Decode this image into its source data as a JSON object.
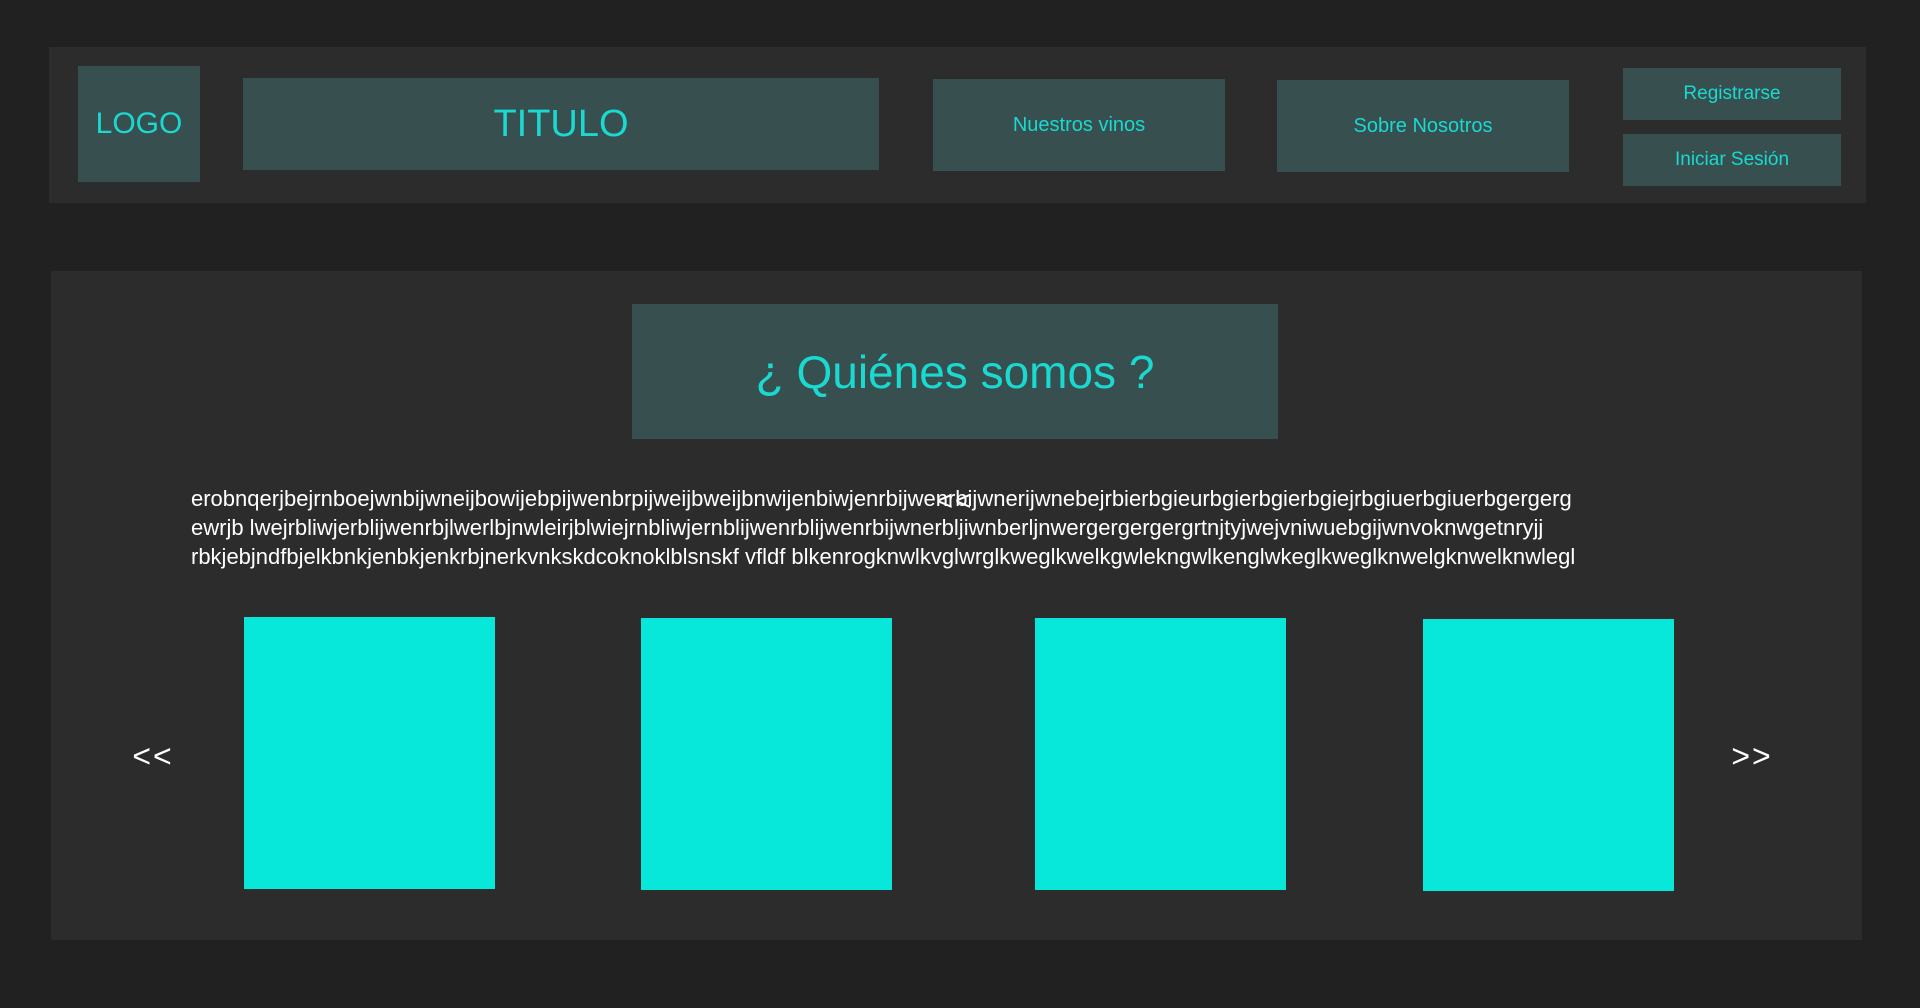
{
  "header": {
    "logo": "LOGO",
    "title": "TITULO",
    "nav": {
      "wines": "Nuestros vinos",
      "about": "Sobre Nosotros",
      "register": "Registrarse",
      "login": "Iniciar Sesión"
    }
  },
  "main": {
    "heading": "¿ Quiénes somos ?",
    "overlay_glyph": "<<",
    "paragraph_lines": [
      "erobnqerjbejrnboejwnbijwneijbowijebpijwenbrpijweijbweijbnwijenbiwjenrbijwenrbijwnerijwnebejrbierbgieurbgierbgierbgiejrbgiuerbgiuerbgergerg",
      "ewrjb lwejrbliwjerblijwenrbjlwerlbjnwleirjblwiejrnbliwjernblijwenrblijwenrbijwnerbljiwnberljnwergergergergrtnjtyjwejvniwuebgijwnvoknwgetnryjj",
      "rbkjebjndfbjelkbnkjenbkjenkrbjnerkvnkskdcoknoklblsnskf vfldf blkenrogknwlkvglwrglkweglkwelkgwlekngwlkenglwkeglkweglknwelgknwelknwlegl"
    ],
    "carousel": {
      "prev_label": "<<",
      "next_label": ">>",
      "slides": 4
    }
  },
  "colors": {
    "background": "#212121",
    "panel": "#2c2c2c",
    "tile": "#384f50",
    "accent_text": "#19d9d0",
    "photo": "#08e8da"
  }
}
